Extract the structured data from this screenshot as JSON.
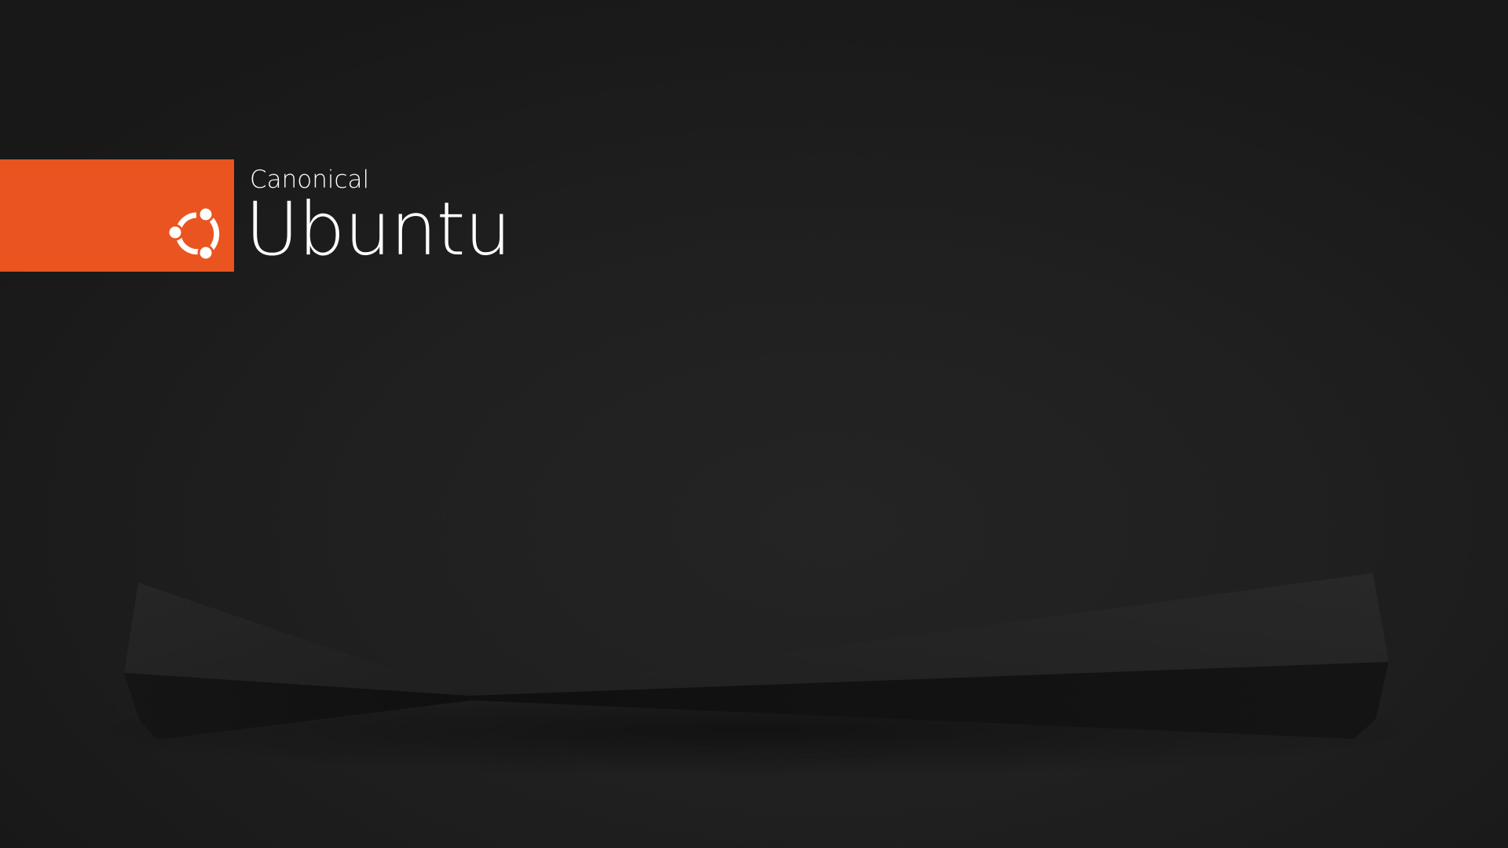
{
  "desktop": {
    "background_color": "#1c1c1c",
    "accent_color": "#E95420",
    "logo": {
      "brand_small": "Canonical",
      "brand_large": "Ubuntu",
      "icon": "circle-of-friends-icon"
    }
  }
}
